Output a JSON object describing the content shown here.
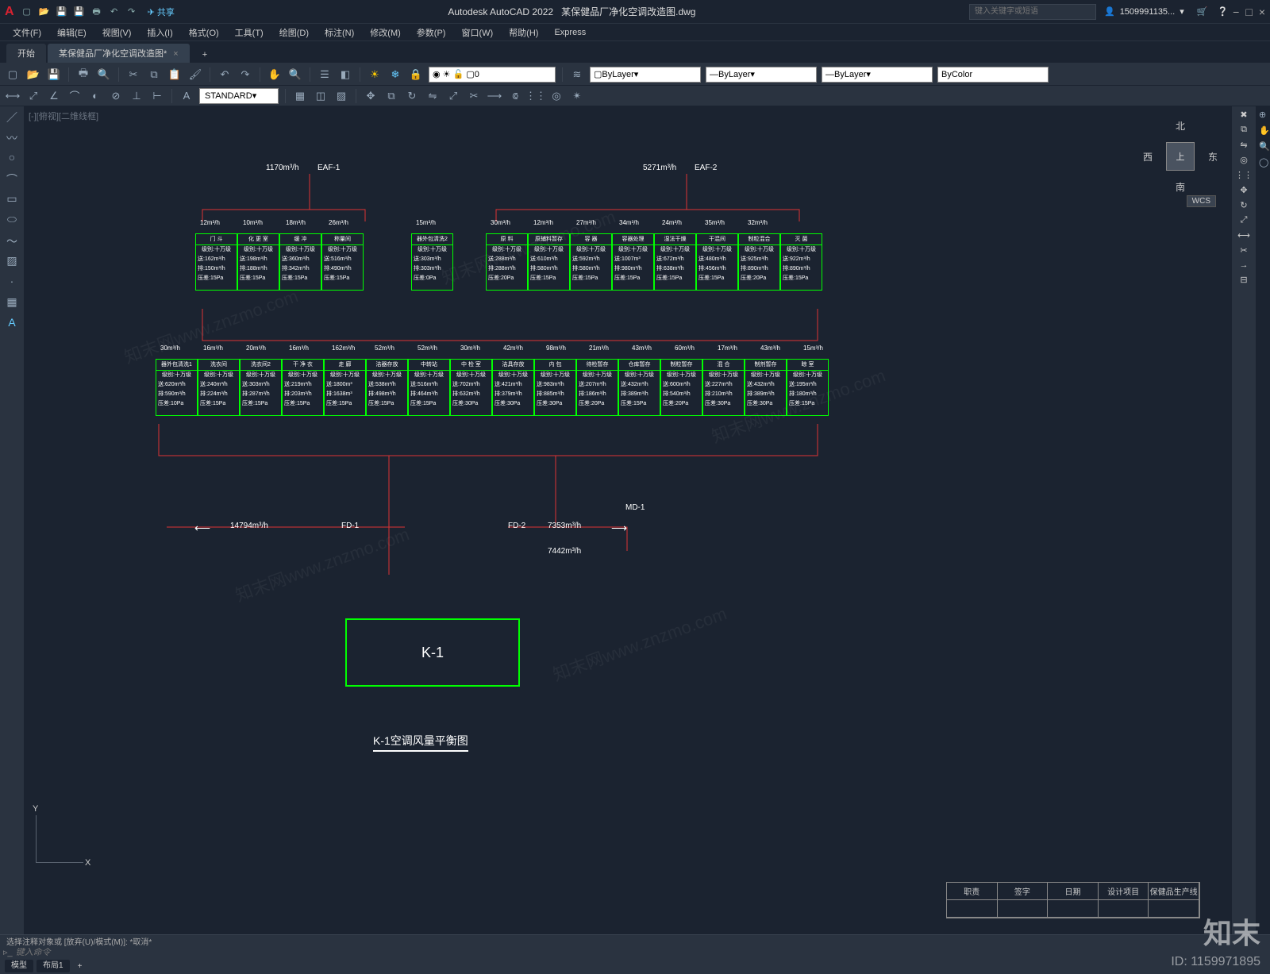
{
  "title": {
    "app": "Autodesk AutoCAD 2022",
    "doc": "某保健品厂净化空调改造图.dwg"
  },
  "search_ph": "键入关键字或短语",
  "account": "1509991135...",
  "share": "共享",
  "winbtns": [
    "−",
    "□",
    "×"
  ],
  "menus": [
    "文件(F)",
    "编辑(E)",
    "视图(V)",
    "插入(I)",
    "格式(O)",
    "工具(T)",
    "绘图(D)",
    "标注(N)",
    "修改(M)",
    "参数(P)",
    "窗口(W)",
    "帮助(H)",
    "Express"
  ],
  "tabs": [
    {
      "label": "开始"
    },
    {
      "label": "某保健品厂净化空调改造图*",
      "active": true
    }
  ],
  "layer_props": {
    "layer": "0",
    "bylayer1": "ByLayer",
    "bylayer2": "ByLayer",
    "bylayer3": "ByLayer",
    "bycolor": "ByColor"
  },
  "txt_style": "STANDARD",
  "viewtab": "[-][俯视][二维线框]",
  "viewcube": {
    "top": "上",
    "n": "北",
    "s": "南",
    "e": "东",
    "w": "西",
    "wcs": "WCS"
  },
  "drawing": {
    "title": "K-1空调风量平衡图",
    "k1": "K-1",
    "eaf1": {
      "name": "EAF-1",
      "flow": "1170m³/h"
    },
    "eaf2": {
      "name": "EAF-2",
      "flow": "5271m³/h"
    },
    "fd1": "FD-1",
    "fd2": "FD-2",
    "md1": "MD-1",
    "fd1_flow": "14794m³/h",
    "fd2_flow": "7353m³/h",
    "md1_flow": "7442m³/h",
    "row1_exh": [
      "12m³/h",
      "10m³/h",
      "18m³/h",
      "26m³/h"
    ],
    "row1b_exh": [
      "15m³/h"
    ],
    "row1c_exh": [
      "30m³/h",
      "12m³/h",
      "27m³/h",
      "34m³/h",
      "24m³/h",
      "35m³/h",
      "32m³/h"
    ],
    "row2_exh": [
      "30m³/h",
      "16m³/h",
      "20m³/h",
      "16m³/h",
      "162m³/h",
      "52m³/h",
      "52m³/h",
      "30m³/h",
      "42m³/h",
      "98m³/h",
      "21m³/h",
      "43m³/h",
      "60m³/h",
      "17m³/h",
      "43m³/h",
      "15m³/h"
    ],
    "row1": [
      {
        "n": "门 斗",
        "l": "级别:十万级",
        "s": "送:162m³/h",
        "r": "排:150m³/h",
        "p": "压差:15Pa"
      },
      {
        "n": "化 更 室",
        "l": "级别:十万级",
        "s": "送:198m³/h",
        "r": "排:188m³/h",
        "p": "压差:15Pa"
      },
      {
        "n": "缓 冲",
        "l": "级别:十万级",
        "s": "送:360m³/h",
        "r": "排:342m³/h",
        "p": "压差:15Pa"
      },
      {
        "n": "称量间",
        "l": "级别:十万级",
        "s": "送:516m³/h",
        "r": "排:490m³/h",
        "p": "压差:15Pa"
      }
    ],
    "row1b": [
      {
        "n": "器外包清洗2",
        "l": "级别:十万级",
        "s": "送:303m³/h",
        "r": "排:303m³/h",
        "p": "压差:0Pa"
      }
    ],
    "row1c": [
      {
        "n": "原 料",
        "l": "级别:十万级",
        "s": "送:288m³/h",
        "r": "排:288m³/h",
        "p": "压差:20Pa"
      },
      {
        "n": "原辅料暂存",
        "l": "级别:十万级",
        "s": "送:610m³/h",
        "r": "排:580m³/h",
        "p": "压差:15Pa"
      },
      {
        "n": "容 器",
        "l": "级别:十万级",
        "s": "送:592m³/h",
        "r": "排:580m³/h",
        "p": "压差:15Pa"
      },
      {
        "n": "容器处理",
        "l": "级别:十万级",
        "s": "送:1007m³",
        "r": "排:980m³/h",
        "p": "压差:15Pa"
      },
      {
        "n": "湿法干燥",
        "l": "级别:十万级",
        "s": "送:672m³/h",
        "r": "排:638m³/h",
        "p": "压差:15Pa"
      },
      {
        "n": "干混间",
        "l": "级别:十万级",
        "s": "送:480m³/h",
        "r": "排:456m³/h",
        "p": "压差:15Pa"
      },
      {
        "n": "制粒混合",
        "l": "级别:十万级",
        "s": "送:925m³/h",
        "r": "排:890m³/h",
        "p": "压差:20Pa"
      },
      {
        "n": "灭 菌",
        "l": "级别:十万级",
        "s": "送:922m³/h",
        "r": "排:890m³/h",
        "p": "压差:15Pa"
      }
    ],
    "row2": [
      {
        "n": "器外包清洗1",
        "l": "级别:十万级",
        "s": "送:620m³/h",
        "r": "排:590m³/h",
        "p": "压差:10Pa"
      },
      {
        "n": "洗衣间",
        "l": "级别:十万级",
        "s": "送:240m³/h",
        "r": "排:224m³/h",
        "p": "压差:15Pa"
      },
      {
        "n": "洗衣间2",
        "l": "级别:十万级",
        "s": "送:303m³/h",
        "r": "排:287m³/h",
        "p": "压差:15Pa"
      },
      {
        "n": "干 净 衣",
        "l": "级别:十万级",
        "s": "送:219m³/h",
        "r": "排:203m³/h",
        "p": "压差:15Pa"
      },
      {
        "n": "走 廊",
        "l": "级别:十万级",
        "s": "送:1800m³",
        "r": "排:1638m³",
        "p": "压差:15Pa"
      },
      {
        "n": "洁器存放",
        "l": "级别:十万级",
        "s": "送:538m³/h",
        "r": "排:498m³/h",
        "p": "压差:15Pa"
      },
      {
        "n": "中转站",
        "l": "级别:十万级",
        "s": "送:516m³/h",
        "r": "排:464m³/h",
        "p": "压差:15Pa"
      },
      {
        "n": "中 检 室",
        "l": "级别:十万级",
        "s": "送:702m³/h",
        "r": "排:632m³/h",
        "p": "压差:30Pa"
      },
      {
        "n": "洁具存放",
        "l": "级别:十万级",
        "s": "送:421m³/h",
        "r": "排:379m³/h",
        "p": "压差:30Pa"
      },
      {
        "n": "内 包",
        "l": "级别:十万级",
        "s": "送:983m³/h",
        "r": "排:885m³/h",
        "p": "压差:30Pa"
      },
      {
        "n": "待检暂存",
        "l": "级别:十万级",
        "s": "送:207m³/h",
        "r": "排:186m³/h",
        "p": "压差:20Pa"
      },
      {
        "n": "仓库暂存",
        "l": "级别:十万级",
        "s": "送:432m³/h",
        "r": "排:389m³/h",
        "p": "压差:15Pa"
      },
      {
        "n": "制粒暂存",
        "l": "级别:十万级",
        "s": "送:600m³/h",
        "r": "排:540m³/h",
        "p": "压差:20Pa"
      },
      {
        "n": "混 合",
        "l": "级别:十万级",
        "s": "送:227m³/h",
        "r": "排:210m³/h",
        "p": "压差:30Pa"
      },
      {
        "n": "制剂暂存",
        "l": "级别:十万级",
        "s": "送:432m³/h",
        "r": "排:389m³/h",
        "p": "压差:30Pa"
      },
      {
        "n": "晾 室",
        "l": "级别:十万级",
        "s": "送:195m³/h",
        "r": "排:180m³/h",
        "p": "压差:15Pa"
      }
    ],
    "tb": {
      "h1": "职责",
      "h2": "签字",
      "h3": "日期",
      "proj": "设计项目",
      "prod": "保健品生产线"
    }
  },
  "cmd": {
    "hist": "选择注释对象或 [放弃(U)/模式(M)]: *取消*",
    "ph": "键入命令"
  },
  "status": {
    "model": "模型",
    "layout": "布局1"
  },
  "watermark": "知末网www.znzmo.com",
  "brand": "知末",
  "imgid": "ID: 1159971895"
}
